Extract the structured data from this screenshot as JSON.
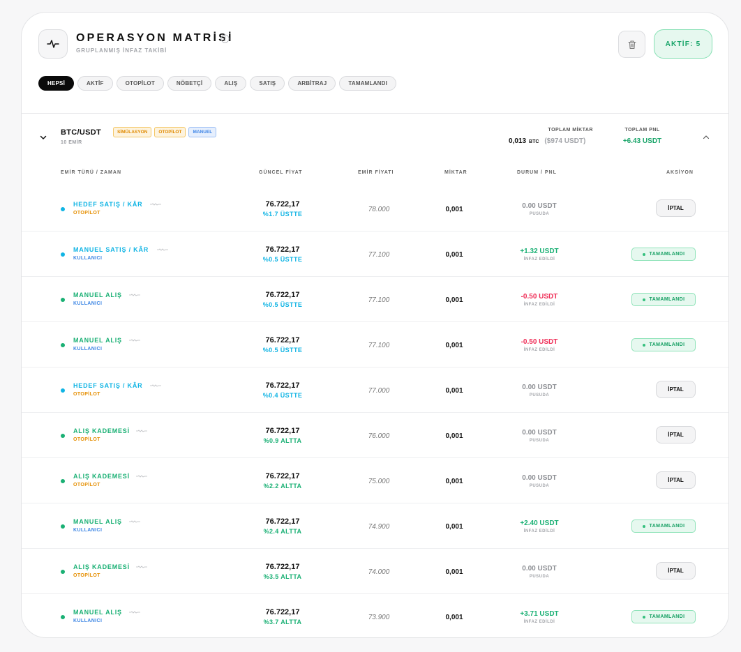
{
  "header": {
    "title": "OPERASYON MATRİSİ",
    "subtitle": "GRUPLANMIŞ İNFAZ TAKİBİ",
    "active_label": "AKTİF: 5"
  },
  "filters": [
    "HEPSİ",
    "AKTİF",
    "OTOPİLOT",
    "NÖBETÇİ",
    "ALIŞ",
    "SATIŞ",
    "ARBİTRAJ",
    "TAMAMLANDI"
  ],
  "active_filter": 0,
  "group": {
    "pair": "BTC/USDT",
    "count": "10 EMİR",
    "badges": [
      "SİMÜLASYON",
      "OTOPİLOT",
      "MANUEL"
    ],
    "total_qty_label": "TOPLAM MİKTAR",
    "total_qty": "0,013",
    "total_qty_unit": "BTC",
    "total_qty_usd": "($974 USDT)",
    "total_pnl_label": "TOPLAM PNL",
    "total_pnl": "+6.43 USDT"
  },
  "columns": {
    "type": "EMİR TÜRÜ / ZAMAN",
    "current": "GÜNCEL FİYAT",
    "order": "EMİR FİYATI",
    "qty": "MİKTAR",
    "status": "DURUM / PNL",
    "action": "AKSİYON"
  },
  "colors": {
    "cyan": "#10b4e4",
    "green": "#1ab074",
    "red": "#ef2f58",
    "orange": "#e58e00",
    "blue": "#3d86e4"
  },
  "rows": [
    {
      "type": "HEDEF SATIŞ / KÂR",
      "type_color": "cyan",
      "source": "OTOPİLOT",
      "source_color": "orange",
      "current": "76.722,17",
      "delta": "%1.7 ÜSTTE",
      "delta_color": "cyan",
      "order_price": "78.000",
      "qty": "0,001",
      "pnl": "0.00 USDT",
      "pnl_color": "gray",
      "status": "PUSUDA",
      "action": "İPTAL",
      "action_type": "cancel"
    },
    {
      "type": "MANUEL SATIŞ / KÂR",
      "type_color": "cyan",
      "source": "KULLANICI",
      "source_color": "blue",
      "current": "76.722,17",
      "delta": "%0.5 ÜSTTE",
      "delta_color": "cyan",
      "order_price": "77.100",
      "qty": "0,001",
      "pnl": "+1.32 USDT",
      "pnl_color": "green",
      "status": "İNFAZ EDİLDİ",
      "action": "TAMAMLANDI",
      "action_type": "done"
    },
    {
      "type": "MANUEL ALIŞ",
      "type_color": "green",
      "source": "KULLANICI",
      "source_color": "blue",
      "current": "76.722,17",
      "delta": "%0.5 ÜSTTE",
      "delta_color": "cyan",
      "order_price": "77.100",
      "qty": "0,001",
      "pnl": "-0.50 USDT",
      "pnl_color": "red",
      "status": "İNFAZ EDİLDİ",
      "action": "TAMAMLANDI",
      "action_type": "done"
    },
    {
      "type": "MANUEL ALIŞ",
      "type_color": "green",
      "source": "KULLANICI",
      "source_color": "blue",
      "current": "76.722,17",
      "delta": "%0.5 ÜSTTE",
      "delta_color": "cyan",
      "order_price": "77.100",
      "qty": "0,001",
      "pnl": "-0.50 USDT",
      "pnl_color": "red",
      "status": "İNFAZ EDİLDİ",
      "action": "TAMAMLANDI",
      "action_type": "done"
    },
    {
      "type": "HEDEF SATIŞ / KÂR",
      "type_color": "cyan",
      "source": "OTOPİLOT",
      "source_color": "orange",
      "current": "76.722,17",
      "delta": "%0.4 ÜSTTE",
      "delta_color": "cyan",
      "order_price": "77.000",
      "qty": "0,001",
      "pnl": "0.00 USDT",
      "pnl_color": "gray",
      "status": "PUSUDA",
      "action": "İPTAL",
      "action_type": "cancel"
    },
    {
      "type": "ALIŞ KADEMESİ",
      "type_color": "green",
      "source": "OTOPİLOT",
      "source_color": "orange",
      "current": "76.722,17",
      "delta": "%0.9 ALTTA",
      "delta_color": "green",
      "order_price": "76.000",
      "qty": "0,001",
      "pnl": "0.00 USDT",
      "pnl_color": "gray",
      "status": "PUSUDA",
      "action": "İPTAL",
      "action_type": "cancel"
    },
    {
      "type": "ALIŞ KADEMESİ",
      "type_color": "green",
      "source": "OTOPİLOT",
      "source_color": "orange",
      "current": "76.722,17",
      "delta": "%2.2 ALTTA",
      "delta_color": "green",
      "order_price": "75.000",
      "qty": "0,001",
      "pnl": "0.00 USDT",
      "pnl_color": "gray",
      "status": "PUSUDA",
      "action": "İPTAL",
      "action_type": "cancel"
    },
    {
      "type": "MANUEL ALIŞ",
      "type_color": "green",
      "source": "KULLANICI",
      "source_color": "blue",
      "current": "76.722,17",
      "delta": "%2.4 ALTTA",
      "delta_color": "green",
      "order_price": "74.900",
      "qty": "0,001",
      "pnl": "+2.40 USDT",
      "pnl_color": "green",
      "status": "İNFAZ EDİLDİ",
      "action": "TAMAMLANDI",
      "action_type": "done"
    },
    {
      "type": "ALIŞ KADEMESİ",
      "type_color": "green",
      "source": "OTOPİLOT",
      "source_color": "orange",
      "current": "76.722,17",
      "delta": "%3.5 ALTTA",
      "delta_color": "green",
      "order_price": "74.000",
      "qty": "0,001",
      "pnl": "0.00 USDT",
      "pnl_color": "gray",
      "status": "PUSUDA",
      "action": "İPTAL",
      "action_type": "cancel"
    },
    {
      "type": "MANUEL ALIŞ",
      "type_color": "green",
      "source": "KULLANICI",
      "source_color": "blue",
      "current": "76.722,17",
      "delta": "%3.7 ALTTA",
      "delta_color": "green",
      "order_price": "73.900",
      "qty": "0,001",
      "pnl": "+3.71 USDT",
      "pnl_color": "green",
      "status": "İNFAZ EDİLDİ",
      "action": "TAMAMLANDI",
      "action_type": "done"
    }
  ]
}
